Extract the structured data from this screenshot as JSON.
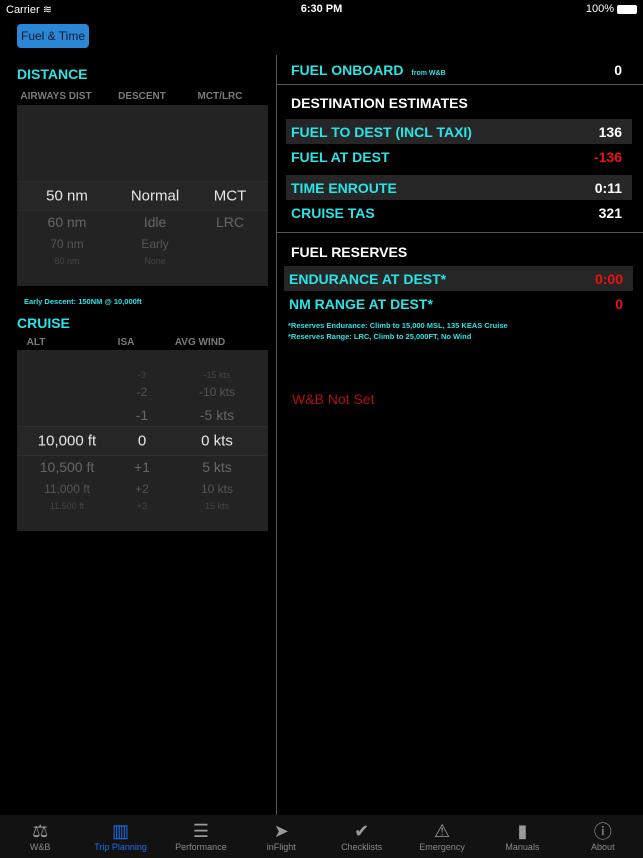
{
  "status_bar": {
    "carrier": "Carrier",
    "time": "6:30 PM",
    "battery": "100%"
  },
  "top_button": "Fuel & Time",
  "distance": {
    "title": "DISTANCE",
    "columns": [
      "AIRWAYS DIST",
      "DESCENT",
      "MCT/LRC"
    ],
    "airways_dist": {
      "selected": "50 nm",
      "below": [
        "60 nm",
        "70 nm",
        "80 nm"
      ]
    },
    "descent": {
      "selected": "Normal",
      "below": [
        "Idle",
        "Early",
        "None"
      ]
    },
    "power": {
      "selected": "MCT",
      "below": [
        "LRC"
      ]
    },
    "note": "Early Descent:  150NM @ 10,000ft"
  },
  "cruise": {
    "title": "CRUISE",
    "columns": [
      "ALT",
      "ISA",
      "AVG WIND"
    ],
    "alt": {
      "selected": "10,000 ft",
      "below": [
        "10,500 ft",
        "11,000 ft",
        "11,500 ft"
      ]
    },
    "isa": {
      "above": [
        "-3",
        "-2",
        "-1"
      ],
      "selected": "0",
      "below": [
        "+1",
        "+2",
        "+3"
      ]
    },
    "wind": {
      "above": [
        "-15 kts",
        "-10 kts",
        "-5 kts"
      ],
      "selected": "0 kts",
      "below": [
        "5 kts",
        "10 kts",
        "15 kts"
      ]
    }
  },
  "fuel_onboard": {
    "label": "FUEL ONBOARD",
    "sub": "from W&B",
    "value": "0"
  },
  "destination": {
    "title": "DESTINATION ESTIMATES",
    "rows": [
      {
        "label": "FUEL TO DEST (INCL TAXI)",
        "value": "136"
      },
      {
        "label": "FUEL AT DEST",
        "value": "-136"
      },
      {
        "label": "TIME ENROUTE",
        "value": "0:11"
      },
      {
        "label": "CRUISE TAS",
        "value": "321"
      }
    ]
  },
  "reserves": {
    "title": "FUEL RESERVES",
    "rows": [
      {
        "label": "ENDURANCE AT DEST*",
        "value": "0:00"
      },
      {
        "label": "NM RANGE AT DEST*",
        "value": "0"
      }
    ],
    "notes": [
      "*Reserves Endurance: Climb to 15,000 MSL, 135 KEAS Cruise",
      "*Reserves Range: LRC, Climb to 25,000FT, No Wind"
    ]
  },
  "warning": "W&B Not Set",
  "colors": {
    "accent": "#29e4e6",
    "negative": "#f01010",
    "active_tab": "#1f6ef0",
    "button": "#2b86d6"
  },
  "tabs": [
    {
      "label": "W&B",
      "icon": "scale-icon"
    },
    {
      "label": "Trip Planning",
      "icon": "map-icon",
      "active": true
    },
    {
      "label": "Performance",
      "icon": "list-icon"
    },
    {
      "label": "inFlight",
      "icon": "paper-plane-icon"
    },
    {
      "label": "Checklists",
      "icon": "checkmark-icon"
    },
    {
      "label": "Emergency",
      "icon": "warning-icon"
    },
    {
      "label": "Manuals",
      "icon": "book-icon"
    },
    {
      "label": "About",
      "icon": "info-icon"
    }
  ]
}
